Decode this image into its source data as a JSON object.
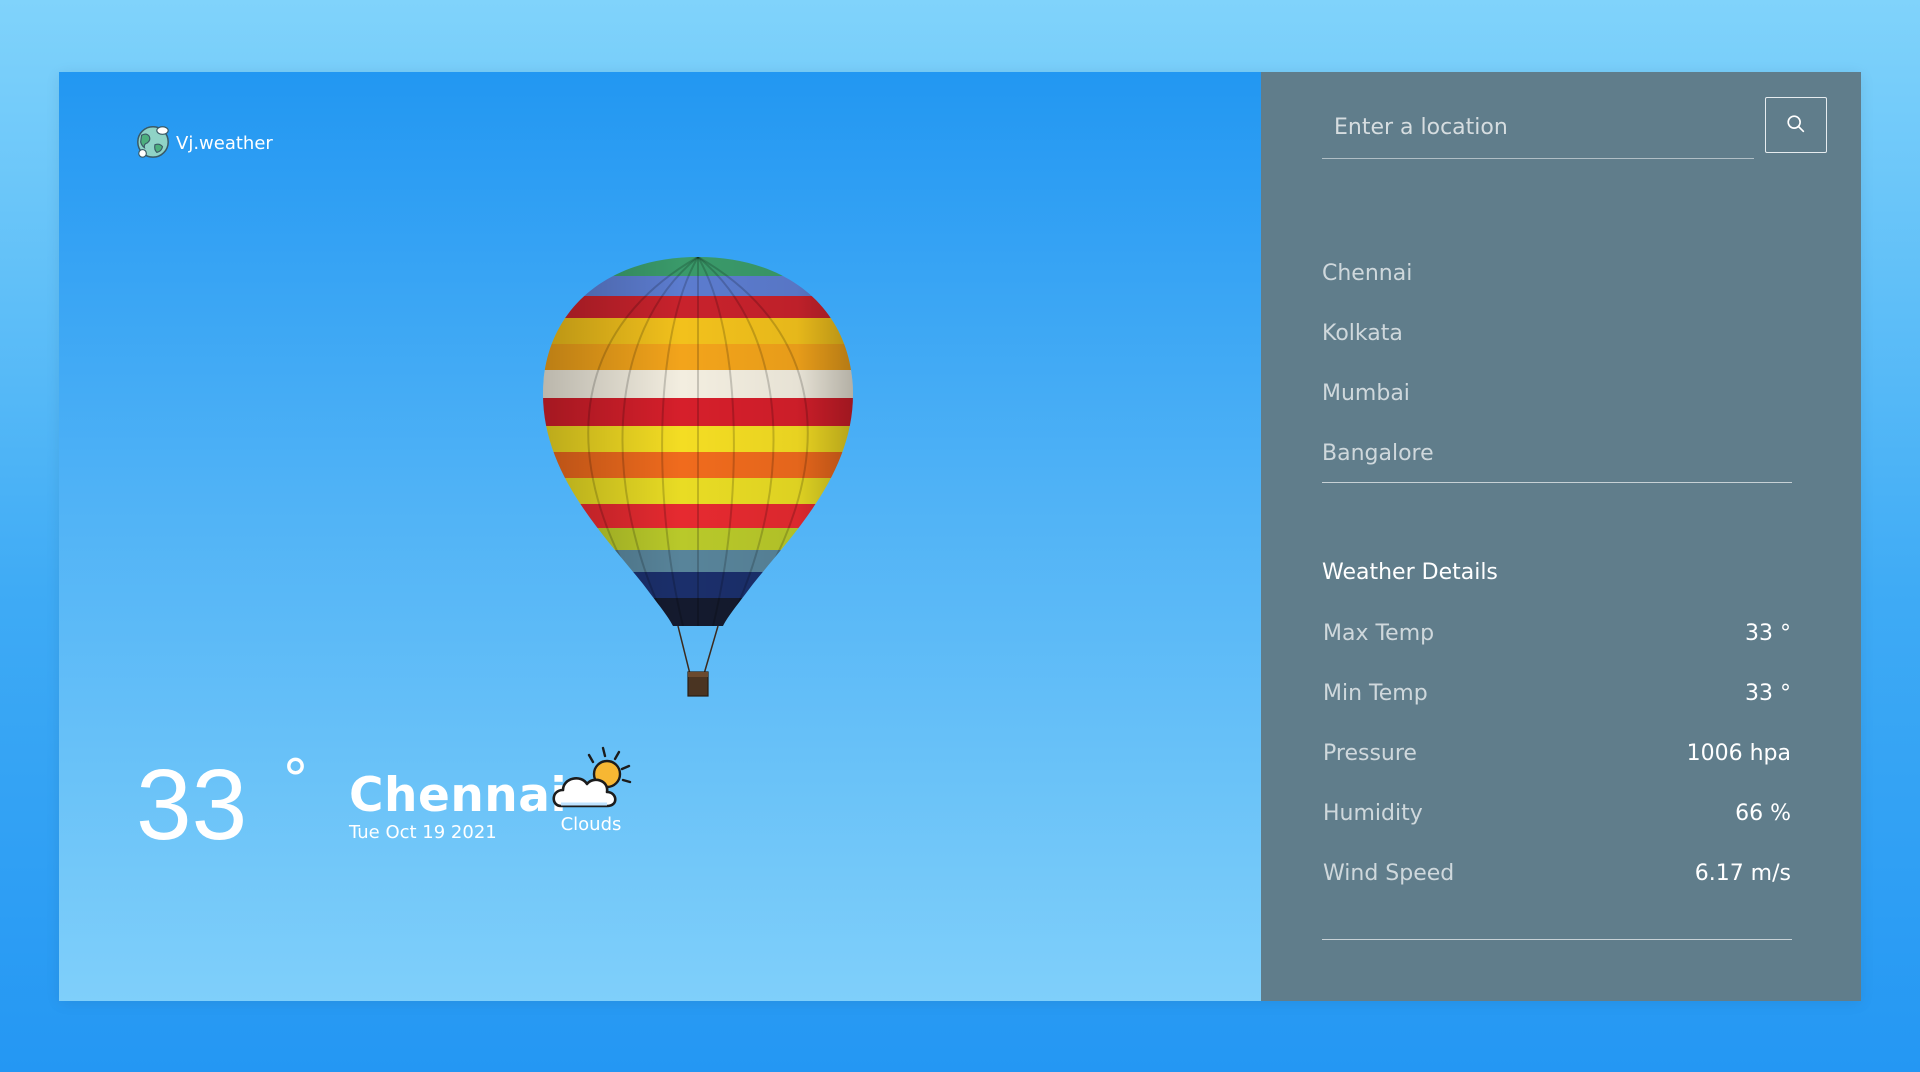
{
  "brand": {
    "name": "Vj.weather",
    "logo_icon": "globe-icon"
  },
  "current": {
    "temperature": "33",
    "degree_symbol": "°",
    "city": "Chennai",
    "date": "Tue Oct 19 2021",
    "condition": "Clouds",
    "condition_icon": "cloud-sun-icon"
  },
  "search": {
    "placeholder": "Enter a location",
    "value": "",
    "button_icon": "search-icon"
  },
  "cities": [
    "Chennai",
    "Kolkata",
    "Mumbai",
    "Bangalore"
  ],
  "details": {
    "title": "Weather Details",
    "items": [
      {
        "label": "Max Temp",
        "value": "33 °"
      },
      {
        "label": "Min Temp",
        "value": "33 °"
      },
      {
        "label": "Pressure",
        "value": "1006 hpa"
      },
      {
        "label": "Humidity",
        "value": "66 %"
      },
      {
        "label": "Wind Speed",
        "value": "6.17 m/s"
      }
    ]
  },
  "colors": {
    "panel_bg": "#607d8b",
    "sky_top": "#2297f2",
    "sky_bottom": "#7fcffa",
    "text_primary": "#ffffff",
    "text_muted": "#cfd8dc"
  }
}
